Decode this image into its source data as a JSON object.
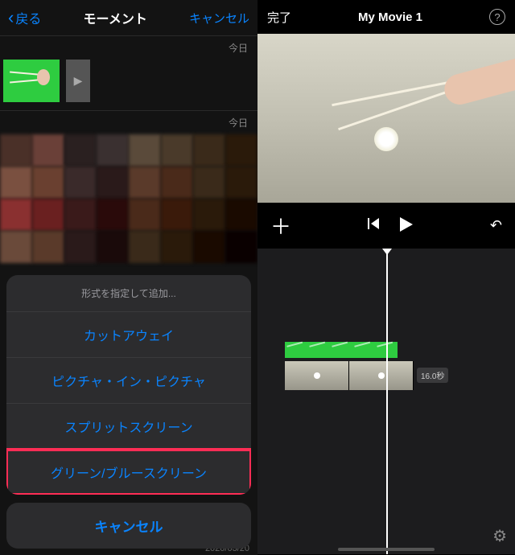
{
  "left": {
    "back": "戻る",
    "title": "モーメント",
    "cancel": "キャンセル",
    "section1": "今日",
    "section2": "今日",
    "sheet": {
      "heading": "形式を指定して追加...",
      "items": [
        "カットアウェイ",
        "ピクチャ・イン・ピクチャ",
        "スプリットスクリーン",
        "グリーン/ブルースクリーン"
      ],
      "highlighted_index": 3,
      "cancel": "キャンセル"
    },
    "bg_date": "2020/03/20"
  },
  "right": {
    "done": "完了",
    "title": "My Movie 1",
    "help": "?",
    "playbar": {
      "plus": "＋",
      "prev": "▮◀",
      "play": "▶",
      "undo": "↶"
    },
    "duration": "16.0秒",
    "gear": "⚙"
  }
}
